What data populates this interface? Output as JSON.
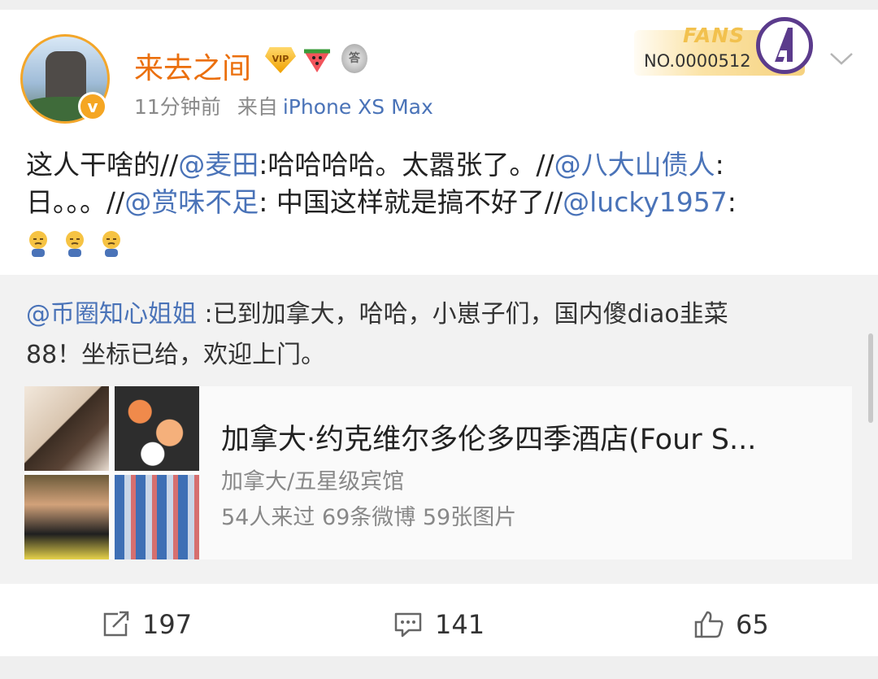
{
  "post": {
    "username": "来去之间",
    "badges": {
      "vip": "VIP",
      "medal": "答"
    },
    "avatar_badge": "v",
    "time": "11分钟前",
    "source_label": "来自",
    "device": "iPhone XS Max",
    "fans": {
      "label": "FANS",
      "number": "NO.0000512"
    },
    "content": {
      "line1_a": "这人干啥的//",
      "m1": "@麦田",
      "line1_b": ":哈哈哈哈。太嚣张了。//",
      "m2": "@八大山债人",
      "line1_c": ":",
      "line2_a": "日。。。//",
      "m3": "@赏味不足",
      "line2_b": ": 中国这样就是搞不好了//",
      "m4": "@lucky1957",
      "line2_c": ":"
    },
    "emojis": [
      "sad-emoji",
      "sad-emoji",
      "sad-emoji"
    ]
  },
  "repost": {
    "mention": "@币圈知心姐姐",
    "text_a": " :已到加拿大，哈哈，小崽子们，国内傻diao韭菜",
    "text_b": "88！坐标已给，欢迎上门。",
    "place": {
      "title": "加拿大·约克维尔多伦多四季酒店(Four S...",
      "category": "加拿大/五星级宾馆",
      "stats": "54人来过 69条微博 59张图片"
    }
  },
  "actions": {
    "repost_count": "197",
    "comment_count": "141",
    "like_count": "65"
  },
  "colors": {
    "username": "#eb6f0c",
    "link": "#4a73b8",
    "meta": "#8a8a8a",
    "repost_bg": "#f2f2f2"
  }
}
